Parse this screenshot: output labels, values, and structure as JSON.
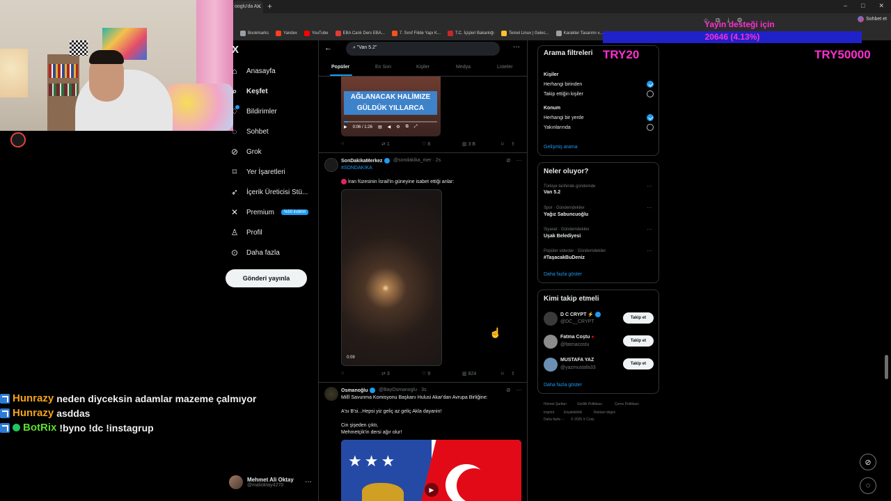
{
  "browser": {
    "tab_title": "ooglu'da A...",
    "window_controls": [
      "–",
      "□",
      "✕"
    ],
    "profile_label": "Sohbet et",
    "bookmarks": [
      {
        "label": "Bookmarks",
        "color": "#9aa0a6"
      },
      {
        "label": "Yandex",
        "color": "#fc3f1d"
      },
      {
        "label": "YouTube",
        "color": "#ff0000"
      },
      {
        "label": "EBA Canlı Ders EBA...",
        "color": "#e53935"
      },
      {
        "label": "7. Sınıf Fiilde Yapı K...",
        "color": "#f4511e"
      },
      {
        "label": "T.C. İçişleri Bakanlığı",
        "color": "#c62828"
      },
      {
        "label": "Temel Linux | Gelec...",
        "color": "#fbc02d"
      },
      {
        "label": "Karakter Tasarımı v...",
        "color": "#9e9e9e"
      }
    ]
  },
  "chat": [
    {
      "user": "Hunrazy",
      "message": "neden diyceksin adamlar mazeme çalmıyor",
      "user_color": "orange"
    },
    {
      "user": "Hunrazy",
      "message": "asddas",
      "user_color": "orange"
    },
    {
      "user": "BotRix",
      "message": "!byno !dc !instagrup",
      "user_color": "green"
    }
  ],
  "nav": {
    "logo": "X",
    "items": [
      {
        "label": "Anasayfa",
        "icon": "home-icon"
      },
      {
        "label": "Keşfet",
        "icon": "search-icon"
      },
      {
        "label": "Bildirimler",
        "icon": "bell-icon"
      },
      {
        "label": "Sohbet",
        "icon": "chat-icon"
      },
      {
        "label": "Grok",
        "icon": "grok-icon"
      },
      {
        "label": "Yer İşaretleri",
        "icon": "bookmark-icon"
      },
      {
        "label": "İçerik Üreticisi Stü...",
        "icon": "rocket-icon"
      },
      {
        "label": "Premium",
        "icon": "x-icon"
      },
      {
        "label": "Profil",
        "icon": "user-icon"
      },
      {
        "label": "Daha fazla",
        "icon": "more-icon"
      }
    ],
    "premium_badge": "%50 indirim",
    "post_button": "Gönderi yayınla",
    "account": {
      "name": "Mehmet Ali Oktay",
      "handle": "@malioktay4270"
    }
  },
  "search": {
    "query": "\"Van 5.2\"",
    "tabs": [
      "Popüler",
      "En Son",
      "Kişiler",
      "Medya",
      "Listeler"
    ]
  },
  "tweets": [
    {
      "video_caption_line1": "AĞLANACAK HALİMIZE",
      "video_caption_line2": "GÜLDÜK YILLARCA",
      "video_time": "0:06 / 1:26",
      "retweets": "1",
      "likes": "8",
      "views": "3 B"
    },
    {
      "name": "SonDakikaMerkez",
      "handle": "@sondakika_mer · 2s",
      "hashtag": "#SONDAKIKA",
      "text": "İran füzesinin İsrail'in güneyine isabet ettiği anlar:",
      "video_time": "0:09",
      "retweets": "3",
      "likes": "9",
      "views": "824"
    },
    {
      "name": "Osmanoğlu",
      "handle": "@BayOsmanoglu · 3s",
      "line1": "Millî Savunma Komisyonu Başkanı Hulusi Akar'dan Avrupa Birliğine:",
      "line2": "A'sı B'si...Hepsi yiz geliç az geliç Akla dayanin!",
      "line3": "Cin şişeden çıktı,",
      "line4": "Mehmetçik'in dersi ağır olur!"
    }
  ],
  "sidebar": {
    "filters_title": "Arama filtreleri",
    "people_title": "Kişiler",
    "people_opt1": "Herhangi birinden",
    "people_opt2": "Takip ettiğin kişiler",
    "location_title": "Konum",
    "location_opt1": "Herhangi bir yerde",
    "location_opt2": "Yakınlarında",
    "advanced": "Gelişmiş arama",
    "trends_title": "Neler oluyor?",
    "trends": [
      {
        "meta": "Türkiye tarihinde gündemde",
        "name": "Van 5.2"
      },
      {
        "meta": "Spor · Gündemdekiler",
        "name": "Yağız Sabuncuoğlu"
      },
      {
        "meta": "Siyaset · Gündemdekiler",
        "name": "Uşak Belediyesi"
      },
      {
        "meta": "Popüler videolar · Gündemdekiler",
        "name": "#TaşacakBuDeniz"
      }
    ],
    "trends_more": "Daha fazla göster",
    "who_title": "Kimi takip etmeli",
    "who": [
      {
        "name": "D C CRYPT",
        "handle": "@DC__CRYPT",
        "avatar_color": "#3a3a3a"
      },
      {
        "name": "Fatma Coştu",
        "handle": "@fatmacostu",
        "avatar_color": "#8c8c8c"
      },
      {
        "name": "MUSTAFA YAZ",
        "handle": "@yazmustafa33",
        "avatar_color": "#6a8fb3"
      }
    ],
    "follow_label": "Takip et",
    "who_more": "Daha fazla göster",
    "footer": [
      "Hizmet Şartları",
      "Gizlilik Politikası",
      "Çerez Politikası",
      "Imprint",
      "Erişilebilirlik",
      "Reklam bilgisi",
      "Daha fazla ···",
      "© 2025 X Corp."
    ]
  },
  "donation": {
    "title": "Yayın desteği için",
    "progress_text": "20646 (4.13%)",
    "progress_fraction": 0.0413,
    "min": "TRY20",
    "max": "TRY50000"
  }
}
